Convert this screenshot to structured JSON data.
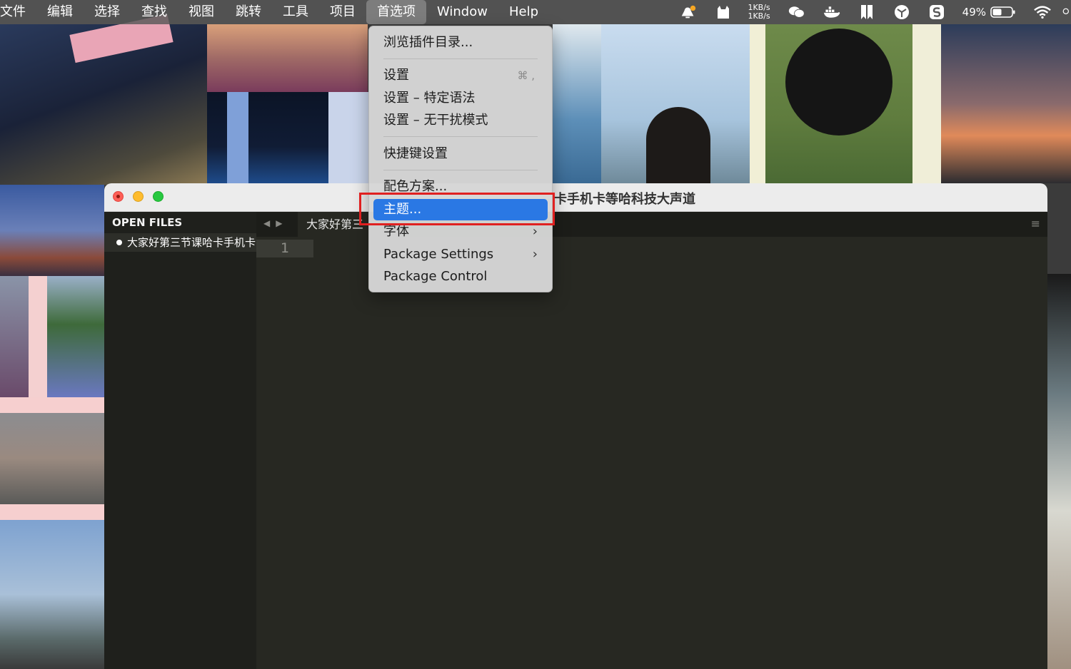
{
  "menubar": {
    "items": [
      "文件",
      "编辑",
      "选择",
      "查找",
      "视图",
      "跳转",
      "工具",
      "项目",
      "首选项",
      "Window",
      "Help"
    ],
    "active_index": 8
  },
  "status": {
    "net_up": "1KB/s",
    "net_down": "1KB/s",
    "battery": "49%"
  },
  "window": {
    "title": "卡手机卡等哈科技大声道",
    "sidebar_header": "OPEN FILES",
    "open_file": "大家好第三节课哈卡手机卡",
    "tab_label": "大家好第三",
    "line_number": "1"
  },
  "menu": {
    "browse": "浏览插件目录...",
    "settings": "设置",
    "settings_shortcut": "⌘ ,",
    "settings_syntax": "设置 – 特定语法",
    "settings_distraction": "设置 – 无干扰模式",
    "keybindings": "快捷键设置",
    "color_scheme": "配色方案...",
    "theme": "主题...",
    "font": "字体",
    "package_settings": "Package Settings",
    "package_control": "Package Control"
  }
}
